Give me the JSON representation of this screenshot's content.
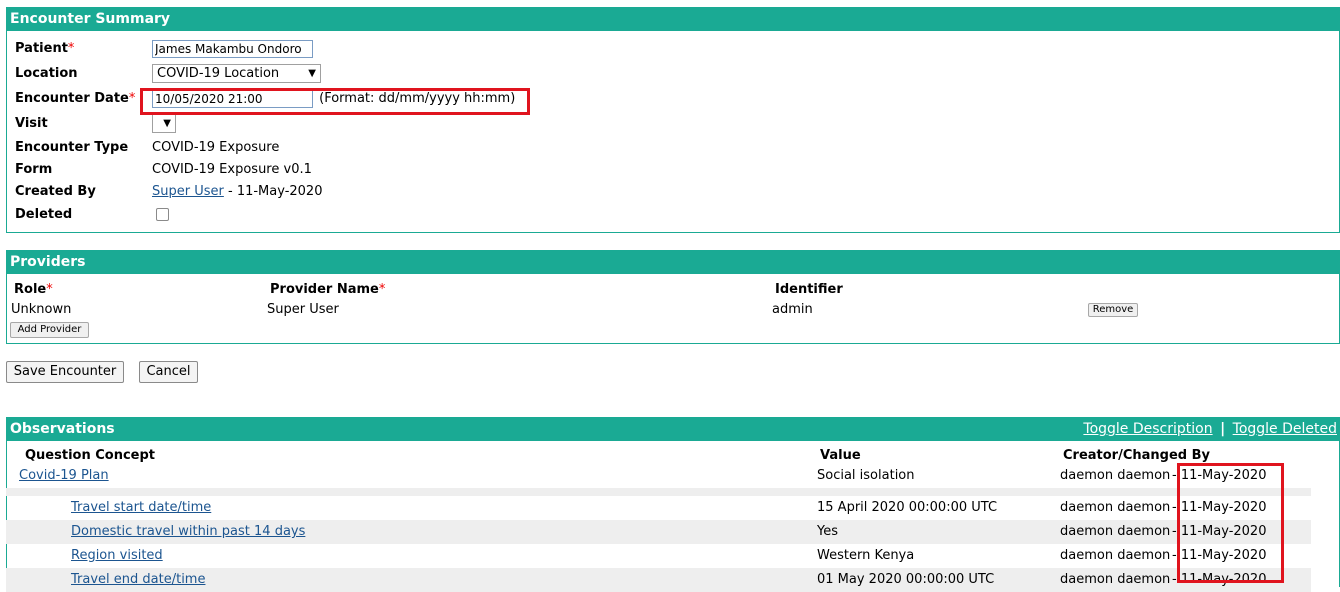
{
  "encounter_summary": {
    "header": "Encounter Summary",
    "patient": {
      "label": "Patient",
      "required": "*",
      "value": "James Makambu Ondoro"
    },
    "location": {
      "label": "Location",
      "value": "COVID-19 Location"
    },
    "encounter_date": {
      "label": "Encounter Date",
      "required": "*",
      "value": "10/05/2020 21:00",
      "format_hint": "(Format: dd/mm/yyyy hh:mm)"
    },
    "visit": {
      "label": "Visit",
      "value": ""
    },
    "encounter_type": {
      "label": "Encounter Type",
      "value": "COVID-19 Exposure"
    },
    "form": {
      "label": "Form",
      "value": "COVID-19 Exposure v0.1"
    },
    "created_by": {
      "label": "Created By",
      "user": "Super User",
      "date": " - 11-May-2020"
    },
    "deleted": {
      "label": "Deleted"
    }
  },
  "providers": {
    "header": "Providers",
    "columns": {
      "role": "Role",
      "name": "Provider Name",
      "identifier": "Identifier",
      "required": "*"
    },
    "rows": [
      {
        "role": "Unknown",
        "name": "Super User",
        "identifier": "admin",
        "remove_label": "Remove"
      }
    ],
    "add_label": "Add Provider"
  },
  "actions": {
    "save_label": "Save Encounter",
    "cancel_label": "Cancel"
  },
  "observations": {
    "header": "Observations",
    "toggle_description": "Toggle Description",
    "separator": "|",
    "toggle_deleted": "Toggle Deleted",
    "columns": {
      "concept": "Question Concept",
      "value": "Value",
      "creator": "Creator/Changed By"
    },
    "rows": [
      {
        "concept": "Covid-19 Plan",
        "value": "Social isolation",
        "creator": "daemon daemon",
        "date": "- 11-May-2020"
      },
      {
        "concept": "Travel start date/time",
        "value": "15 April 2020 00:00:00 UTC",
        "creator": "daemon daemon",
        "date": "- 11-May-2020"
      },
      {
        "concept": "Domestic travel within past 14 days",
        "value": "Yes",
        "creator": "daemon daemon",
        "date": "- 11-May-2020"
      },
      {
        "concept": "Region visited",
        "value": "Western Kenya",
        "creator": "daemon daemon",
        "date": "- 11-May-2020"
      },
      {
        "concept": "Travel end date/time",
        "value": "01 May 2020 00:00:00 UTC",
        "creator": "daemon daemon",
        "date": "- 11-May-2020"
      }
    ]
  }
}
